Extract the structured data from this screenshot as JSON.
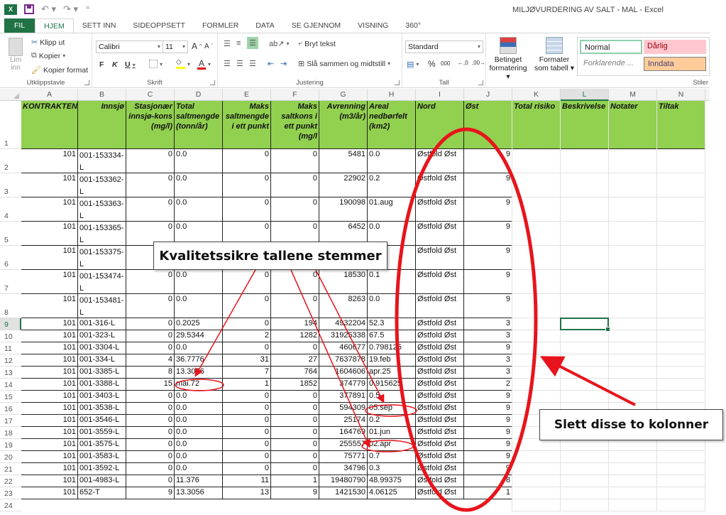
{
  "window": {
    "title": "MILJØVURDERING AV SALT - MAL - Excel",
    "app_icon": "excel-logo-icon",
    "qat_icons": [
      "save-icon",
      "undo-icon",
      "redo-icon",
      "customize-qat-icon"
    ]
  },
  "tabs": [
    {
      "label": "FIL"
    },
    {
      "label": "HJEM",
      "active": true
    },
    {
      "label": "SETT INN"
    },
    {
      "label": "SIDEOPPSETT"
    },
    {
      "label": "FORMLER"
    },
    {
      "label": "DATA"
    },
    {
      "label": "SE GJENNOM"
    },
    {
      "label": "VISNING"
    },
    {
      "label": "360°"
    }
  ],
  "ribbon": {
    "clipboard": {
      "label": "Utklippstavle",
      "paste": "Lim",
      "paste2": "inn",
      "cut": "Klipp ut",
      "copy": "Kopier",
      "format_painter": "Kopier format"
    },
    "font": {
      "label": "Skrift",
      "font_name": "Calibri",
      "font_size": "11",
      "bold": "F",
      "italic": "K",
      "underline": "U",
      "grow": "A",
      "shrink": "A"
    },
    "alignment": {
      "label": "Justering",
      "wrap_text": "Bryt tekst",
      "merge_center": "Slå sammen og midtstill"
    },
    "number": {
      "label": "Tall",
      "format": "Standard",
      "percent": "%",
      "thousands": "000",
      "inc_decimal": "←,0",
      "dec_decimal": ",00→"
    },
    "styles": {
      "label": "Stiler",
      "conditional_1": "Betinget",
      "conditional_2": "formatering",
      "table_1": "Formater",
      "table_2": "som tabell",
      "normal": "Normal",
      "bad": "Dårlig",
      "explanatory": "Forklarende ...",
      "input": "Inndata"
    }
  },
  "sheet": {
    "columns": [
      "A",
      "B",
      "C",
      "D",
      "E",
      "F",
      "G",
      "H",
      "I",
      "J",
      "K",
      "L",
      "M",
      "N"
    ],
    "selected_column": "L",
    "selected_row": 9,
    "header_fill": "#92d050",
    "headers": [
      "KONTRAKTEN",
      "Innsjø",
      "Stasjonær innsjø-kons (mg/l)",
      "Total saltmengde (tonn/år)",
      "Maks saltmengde i ett punkt",
      "Maks saltkons i ett punkt (mg/l",
      "Avrenning (m3/år)",
      "Areal nedbørfelt (km2)",
      "Nord",
      "Øst",
      "Total risiko",
      "Beskrivelse",
      "Notater",
      "Tiltak"
    ],
    "rows": [
      {
        "n": "2",
        "a": "101",
        "b": "001-153334-L",
        "c": "0",
        "d": "0.0",
        "e": "0",
        "f": "0",
        "g": "5481",
        "h": "0.0",
        "i": "Østfold Øst",
        "j": "9"
      },
      {
        "n": "3",
        "a": "101",
        "b": "001-153362-L",
        "c": "0",
        "d": "0.0",
        "e": "0",
        "f": "0",
        "g": "22902",
        "h": "0.2",
        "i": "Østfold Øst",
        "j": "9"
      },
      {
        "n": "4",
        "a": "101",
        "b": "001-153363-L",
        "c": "0",
        "d": "0.0",
        "e": "0",
        "f": "0",
        "g": "190098",
        "h": "01.aug",
        "i": "Østfold Øst",
        "j": "9"
      },
      {
        "n": "5",
        "a": "101",
        "b": "001-153365-L",
        "c": "0",
        "d": "0.0",
        "e": "0",
        "f": "0",
        "g": "6452",
        "h": "0.0",
        "i": "Østfold Øst",
        "j": "9"
      },
      {
        "n": "6",
        "a": "101",
        "b": "001-153375-L",
        "c": "",
        "d": "",
        "e": "",
        "f": "",
        "g": "",
        "h": "",
        "i": "Østfold Øst",
        "j": "9"
      },
      {
        "n": "7",
        "a": "101",
        "b": "001-153474-L",
        "c": "0",
        "d": "0.0",
        "e": "0",
        "f": "0",
        "g": "18530",
        "h": "0.1",
        "i": "Østfold Øst",
        "j": "9"
      },
      {
        "n": "8",
        "a": "101",
        "b": "001-153481-L",
        "c": "0",
        "d": "0.0",
        "e": "0",
        "f": "0",
        "g": "8263",
        "h": "0.0",
        "i": "Østfold Øst",
        "j": "9"
      },
      {
        "n": "9",
        "a": "101",
        "b": "001-316-L",
        "c": "0",
        "d": "0.2025",
        "e": "0",
        "f": "194",
        "g": "4932204",
        "h": "52.3",
        "i": "Østfold Øst",
        "j": "3"
      },
      {
        "n": "10",
        "a": "101",
        "b": "001-323-L",
        "c": "0",
        "d": "29.5344",
        "e": "2",
        "f": "1282",
        "g": "31925338",
        "h": "67.5",
        "i": "Østfold Øst",
        "j": "3"
      },
      {
        "n": "11",
        "a": "101",
        "b": "001-3304-L",
        "c": "0",
        "d": "0.0",
        "e": "0",
        "f": "0",
        "g": "460677",
        "h": "0.798125",
        "i": "Østfold Øst",
        "j": "9"
      },
      {
        "n": "12",
        "a": "101",
        "b": "001-334-L",
        "c": "4",
        "d": "36.7776",
        "e": "31",
        "f": "27",
        "g": "7637878",
        "h": "19.feb",
        "i": "Østfold Øst",
        "j": "3"
      },
      {
        "n": "13",
        "a": "101",
        "b": "001-3385-L",
        "c": "8",
        "d": "13.3056",
        "e": "7",
        "f": "764",
        "g": "1604606",
        "h": "apr.25",
        "i": "Østfold Øst",
        "j": "3"
      },
      {
        "n": "14",
        "a": "101",
        "b": "001-3388-L",
        "c": "15",
        "d": "mai.72",
        "e": "1",
        "f": "1852",
        "g": "374779",
        "h": "0.915625",
        "i": "Østfold Øst",
        "j": "2"
      },
      {
        "n": "15",
        "a": "101",
        "b": "001-3403-L",
        "c": "0",
        "d": "0.0",
        "e": "0",
        "f": "0",
        "g": "377891",
        "h": "0.5",
        "i": "Østfold Øst",
        "j": "9"
      },
      {
        "n": "16",
        "a": "101",
        "b": "001-3538-L",
        "c": "0",
        "d": "0.0",
        "e": "0",
        "f": "0",
        "g": "594309",
        "h": "05.sep",
        "i": "Østfold Øst",
        "j": "9"
      },
      {
        "n": "17",
        "a": "101",
        "b": "001-3546-L",
        "c": "0",
        "d": "0.0",
        "e": "0",
        "f": "0",
        "g": "25174",
        "h": "0.2",
        "i": "Østfold Øst",
        "j": "9"
      },
      {
        "n": "18",
        "a": "101",
        "b": "001-3559-L",
        "c": "0",
        "d": "0.0",
        "e": "0",
        "f": "0",
        "g": "164769",
        "h": "01.jun",
        "i": "Østfold Øst",
        "j": "9"
      },
      {
        "n": "19",
        "a": "101",
        "b": "001-3575-L",
        "c": "0",
        "d": "0.0",
        "e": "0",
        "f": "0",
        "g": "255557",
        "h": "02.apr",
        "i": "Østfold Øst",
        "j": "9"
      },
      {
        "n": "20",
        "a": "101",
        "b": "001-3583-L",
        "c": "0",
        "d": "0.0",
        "e": "0",
        "f": "0",
        "g": "75771",
        "h": "0.7",
        "i": "Østfold Øst",
        "j": "9"
      },
      {
        "n": "21",
        "a": "101",
        "b": "001-3592-L",
        "c": "0",
        "d": "0.0",
        "e": "0",
        "f": "0",
        "g": "34796",
        "h": "0.3",
        "i": "Østfold Øst",
        "j": "9"
      },
      {
        "n": "22",
        "a": "101",
        "b": "001-4983-L",
        "c": "0",
        "d": "11.376",
        "e": "11",
        "f": "1",
        "g": "19480790",
        "h": "48.99375",
        "i": "Østfold Øst",
        "j": "8"
      },
      {
        "n": "23",
        "a": "101",
        "b": "652-T",
        "c": "9",
        "d": "13.3056",
        "e": "13",
        "f": "9",
        "g": "1421530",
        "h": "4.06125",
        "i": "Østfold Øst",
        "j": "1"
      },
      {
        "n": "24",
        "a": "",
        "b": "",
        "c": "",
        "d": "",
        "e": "",
        "f": "",
        "g": "",
        "h": "",
        "i": "",
        "j": ""
      }
    ]
  },
  "annotations": {
    "callout_quality": "Kvalitetssikre tallene stemmer",
    "callout_delete": "Slett disse to kolonner",
    "color": "#e8141b"
  }
}
